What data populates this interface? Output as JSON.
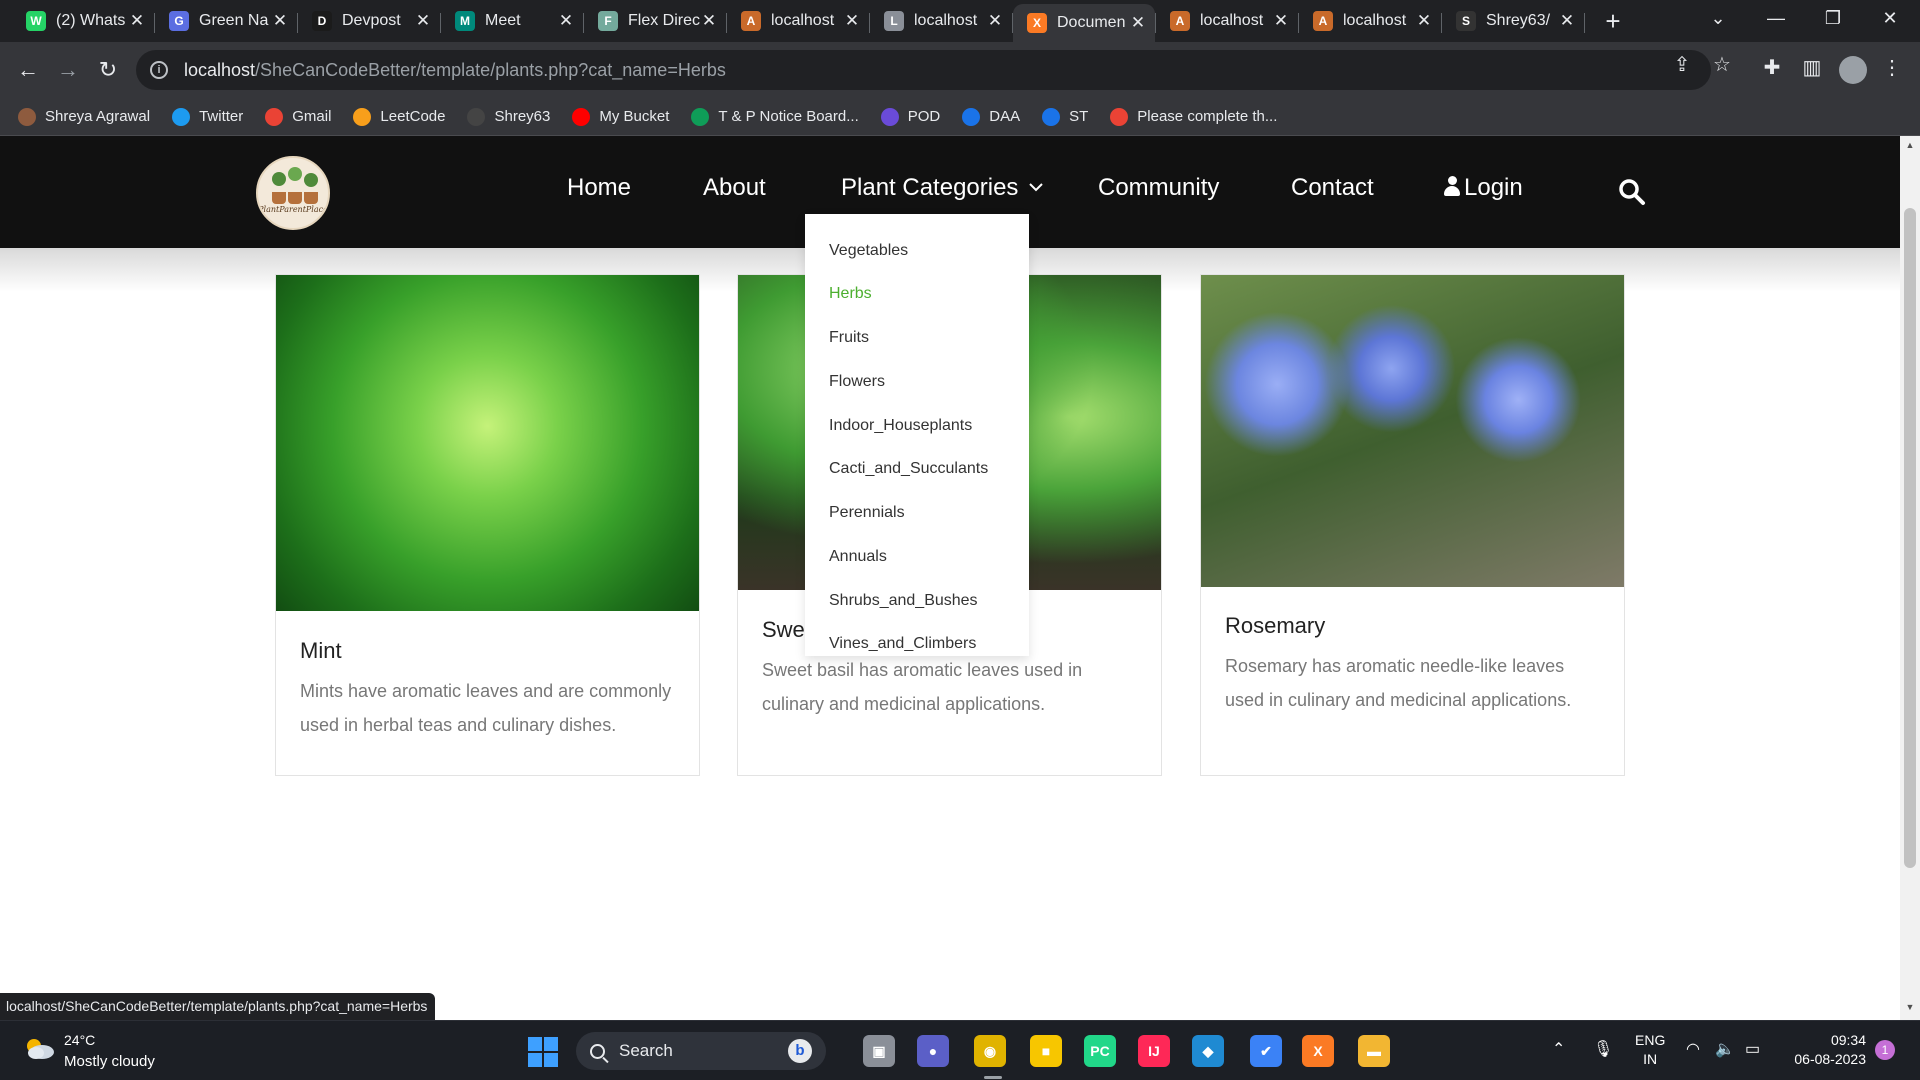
{
  "browser": {
    "tabs": [
      {
        "title": "(2) Whats",
        "icon": "whatsapp-icon",
        "color": "#25d366",
        "glyph": "W"
      },
      {
        "title": "Green Na",
        "icon": "shield-icon",
        "color": "#5b6ee1",
        "glyph": "G"
      },
      {
        "title": "Devpost",
        "icon": "devpost-icon",
        "color": "#1b1b1b",
        "glyph": "D"
      },
      {
        "title": "Meet",
        "icon": "meet-icon",
        "color": "#00897b",
        "glyph": "M"
      },
      {
        "title": "Flex Direc",
        "icon": "chatgpt-icon",
        "color": "#74aa9c",
        "glyph": "F"
      },
      {
        "title": "localhost",
        "icon": "xampp-a-icon",
        "color": "#c96a2a",
        "glyph": "A"
      },
      {
        "title": "localhost",
        "icon": "localhost-icon",
        "color": "#8a8f98",
        "glyph": "L"
      },
      {
        "title": "Documen",
        "icon": "xampp-icon",
        "color": "#fb7a24",
        "glyph": "X"
      },
      {
        "title": "localhost",
        "icon": "xampp-a-icon",
        "color": "#c96a2a",
        "glyph": "A"
      },
      {
        "title": "localhost",
        "icon": "xampp-a-icon",
        "color": "#c96a2a",
        "glyph": "A"
      },
      {
        "title": "Shrey63/",
        "icon": "github-icon",
        "color": "#333333",
        "glyph": "S"
      }
    ],
    "active_tab_index": 7,
    "new_tab_symbol": "+",
    "url_host": "localhost",
    "url_path": "/SheCanCodeBetter/template/plants.php?cat_name=Herbs",
    "bookmarks": [
      {
        "label": "Shreya Agrawal",
        "icon": "avatar-icon",
        "color": "#8e5b3e"
      },
      {
        "label": "Twitter",
        "icon": "twitter-icon",
        "color": "#1d9bf0"
      },
      {
        "label": "Gmail",
        "icon": "gmail-icon",
        "color": "#ea4335"
      },
      {
        "label": "LeetCode",
        "icon": "leetcode-icon",
        "color": "#f89f1b"
      },
      {
        "label": "Shrey63",
        "icon": "github-icon",
        "color": "#444444"
      },
      {
        "label": "My Bucket",
        "icon": "youtube-icon",
        "color": "#ff0000"
      },
      {
        "label": "T & P Notice Board...",
        "icon": "sheets-icon",
        "color": "#0f9d58"
      },
      {
        "label": "POD",
        "icon": "pod-icon",
        "color": "#6a4bd8"
      },
      {
        "label": "DAA",
        "icon": "s-icon",
        "color": "#1a73e8"
      },
      {
        "label": "ST",
        "icon": "s-icon",
        "color": "#1a73e8"
      },
      {
        "label": "Please complete th...",
        "icon": "gmail-icon",
        "color": "#ea4335"
      }
    ],
    "status_url": "localhost/SheCanCodeBetter/template/plants.php?cat_name=Herbs"
  },
  "site": {
    "logo_text": "PlantParentPlace",
    "nav": {
      "home": "Home",
      "about": "About",
      "categories": "Plant Categories",
      "community": "Community",
      "contact": "Contact",
      "login": "Login"
    },
    "dropdown": [
      "Vegetables",
      "Herbs",
      "Fruits",
      "Flowers",
      "Indoor_Houseplants",
      "Cacti_and_Succulants",
      "Perennials",
      "Annuals",
      "Shrubs_and_Bushes",
      "Vines_and_Climbers"
    ],
    "dropdown_selected": "Herbs",
    "accent_color": "#4caf2f",
    "cards": [
      {
        "name": "Mint",
        "desc": "Mints have aromatic leaves and are commonly used in herbal teas and culinary dishes."
      },
      {
        "name": "Sweet Basil",
        "desc": "Sweet basil has aromatic leaves used in culinary and medicinal applications."
      },
      {
        "name": "Rosemary",
        "desc": "Rosemary has aromatic needle-like leaves used in culinary and medicinal applications."
      }
    ]
  },
  "taskbar": {
    "weather_temp": "24°C",
    "weather_cond": "Mostly cloudy",
    "search_label": "Search",
    "lang_line1": "ENG",
    "lang_line2": "IN",
    "time": "09:34",
    "date": "06-08-2023",
    "notification_count": "1",
    "apps": [
      {
        "name": "file-explorer-icon",
        "color": "#8a8f98",
        "glyph": "▣"
      },
      {
        "name": "teams-chat-icon",
        "color": "#5b5fc7",
        "glyph": "●"
      },
      {
        "name": "chrome-icon",
        "color": "#e0b300",
        "glyph": "◉"
      },
      {
        "name": "sticky-notes-icon",
        "color": "#f7c600",
        "glyph": "■"
      },
      {
        "name": "pycharm-icon",
        "color": "#21d789",
        "glyph": "PC"
      },
      {
        "name": "intellij-icon",
        "color": "#fe2857",
        "glyph": "IJ"
      },
      {
        "name": "vscode-icon",
        "color": "#1f8ad2",
        "glyph": "◆"
      },
      {
        "name": "todo-icon",
        "color": "#3b82f6",
        "glyph": "✔"
      },
      {
        "name": "xampp-icon",
        "color": "#fb7a24",
        "glyph": "X"
      },
      {
        "name": "folder-icon",
        "color": "#f2b632",
        "glyph": "▬"
      }
    ]
  }
}
